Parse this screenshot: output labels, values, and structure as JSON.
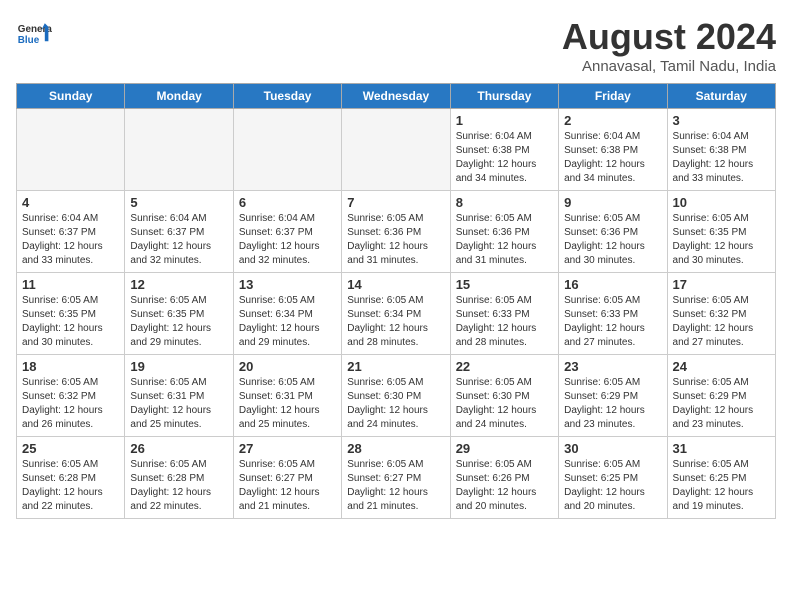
{
  "header": {
    "logo_line1": "General",
    "logo_line2": "Blue",
    "title": "August 2024",
    "subtitle": "Annavasal, Tamil Nadu, India"
  },
  "days_of_week": [
    "Sunday",
    "Monday",
    "Tuesday",
    "Wednesday",
    "Thursday",
    "Friday",
    "Saturday"
  ],
  "weeks": [
    [
      {
        "day": "",
        "empty": true
      },
      {
        "day": "",
        "empty": true
      },
      {
        "day": "",
        "empty": true
      },
      {
        "day": "",
        "empty": true
      },
      {
        "day": "1",
        "sunrise": "6:04 AM",
        "sunset": "6:38 PM",
        "daylight": "12 hours and 34 minutes"
      },
      {
        "day": "2",
        "sunrise": "6:04 AM",
        "sunset": "6:38 PM",
        "daylight": "12 hours and 34 minutes"
      },
      {
        "day": "3",
        "sunrise": "6:04 AM",
        "sunset": "6:38 PM",
        "daylight": "12 hours and 33 minutes"
      }
    ],
    [
      {
        "day": "4",
        "sunrise": "6:04 AM",
        "sunset": "6:37 PM",
        "daylight": "12 hours and 33 minutes"
      },
      {
        "day": "5",
        "sunrise": "6:04 AM",
        "sunset": "6:37 PM",
        "daylight": "12 hours and 32 minutes"
      },
      {
        "day": "6",
        "sunrise": "6:04 AM",
        "sunset": "6:37 PM",
        "daylight": "12 hours and 32 minutes"
      },
      {
        "day": "7",
        "sunrise": "6:05 AM",
        "sunset": "6:36 PM",
        "daylight": "12 hours and 31 minutes"
      },
      {
        "day": "8",
        "sunrise": "6:05 AM",
        "sunset": "6:36 PM",
        "daylight": "12 hours and 31 minutes"
      },
      {
        "day": "9",
        "sunrise": "6:05 AM",
        "sunset": "6:36 PM",
        "daylight": "12 hours and 30 minutes"
      },
      {
        "day": "10",
        "sunrise": "6:05 AM",
        "sunset": "6:35 PM",
        "daylight": "12 hours and 30 minutes"
      }
    ],
    [
      {
        "day": "11",
        "sunrise": "6:05 AM",
        "sunset": "6:35 PM",
        "daylight": "12 hours and 30 minutes"
      },
      {
        "day": "12",
        "sunrise": "6:05 AM",
        "sunset": "6:35 PM",
        "daylight": "12 hours and 29 minutes"
      },
      {
        "day": "13",
        "sunrise": "6:05 AM",
        "sunset": "6:34 PM",
        "daylight": "12 hours and 29 minutes"
      },
      {
        "day": "14",
        "sunrise": "6:05 AM",
        "sunset": "6:34 PM",
        "daylight": "12 hours and 28 minutes"
      },
      {
        "day": "15",
        "sunrise": "6:05 AM",
        "sunset": "6:33 PM",
        "daylight": "12 hours and 28 minutes"
      },
      {
        "day": "16",
        "sunrise": "6:05 AM",
        "sunset": "6:33 PM",
        "daylight": "12 hours and 27 minutes"
      },
      {
        "day": "17",
        "sunrise": "6:05 AM",
        "sunset": "6:32 PM",
        "daylight": "12 hours and 27 minutes"
      }
    ],
    [
      {
        "day": "18",
        "sunrise": "6:05 AM",
        "sunset": "6:32 PM",
        "daylight": "12 hours and 26 minutes"
      },
      {
        "day": "19",
        "sunrise": "6:05 AM",
        "sunset": "6:31 PM",
        "daylight": "12 hours and 25 minutes"
      },
      {
        "day": "20",
        "sunrise": "6:05 AM",
        "sunset": "6:31 PM",
        "daylight": "12 hours and 25 minutes"
      },
      {
        "day": "21",
        "sunrise": "6:05 AM",
        "sunset": "6:30 PM",
        "daylight": "12 hours and 24 minutes"
      },
      {
        "day": "22",
        "sunrise": "6:05 AM",
        "sunset": "6:30 PM",
        "daylight": "12 hours and 24 minutes"
      },
      {
        "day": "23",
        "sunrise": "6:05 AM",
        "sunset": "6:29 PM",
        "daylight": "12 hours and 23 minutes"
      },
      {
        "day": "24",
        "sunrise": "6:05 AM",
        "sunset": "6:29 PM",
        "daylight": "12 hours and 23 minutes"
      }
    ],
    [
      {
        "day": "25",
        "sunrise": "6:05 AM",
        "sunset": "6:28 PM",
        "daylight": "12 hours and 22 minutes"
      },
      {
        "day": "26",
        "sunrise": "6:05 AM",
        "sunset": "6:28 PM",
        "daylight": "12 hours and 22 minutes"
      },
      {
        "day": "27",
        "sunrise": "6:05 AM",
        "sunset": "6:27 PM",
        "daylight": "12 hours and 21 minutes"
      },
      {
        "day": "28",
        "sunrise": "6:05 AM",
        "sunset": "6:27 PM",
        "daylight": "12 hours and 21 minutes"
      },
      {
        "day": "29",
        "sunrise": "6:05 AM",
        "sunset": "6:26 PM",
        "daylight": "12 hours and 20 minutes"
      },
      {
        "day": "30",
        "sunrise": "6:05 AM",
        "sunset": "6:25 PM",
        "daylight": "12 hours and 20 minutes"
      },
      {
        "day": "31",
        "sunrise": "6:05 AM",
        "sunset": "6:25 PM",
        "daylight": "12 hours and 19 minutes"
      }
    ]
  ]
}
